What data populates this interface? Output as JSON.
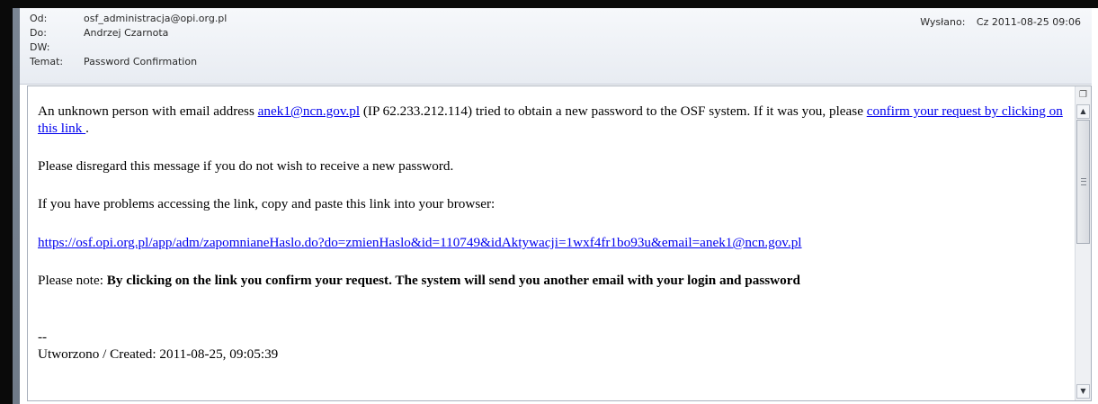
{
  "header": {
    "from_label": "Od:",
    "from_value": "osf_administracja@opi.org.pl",
    "to_label": "Do:",
    "to_value": "Andrzej Czarnota",
    "cc_label": "DW:",
    "cc_value": "",
    "subject_label": "Temat:",
    "subject_value": "Password Confirmation",
    "sent_label": "Wysłano:",
    "sent_value": "Cz 2011-08-25 09:06"
  },
  "message": {
    "p1_prefix": "An unknown person with email address ",
    "p1_email_link": "anek1@ncn.gov.pl",
    "p1_middle": " (IP 62.233.212.114) tried to obtain a new password to the OSF system. If it was you, please ",
    "p1_confirm_link": "confirm your request by clicking on this link ",
    "p1_suffix": ".",
    "p2": "Please disregard this message if you do not wish to receive a new password.",
    "p3": "If you have problems accessing the link, copy and paste this link into your browser:",
    "url_link": "https://osf.opi.org.pl/app/adm/zapomnianeHaslo.do?do=zmienHaslo&id=110749&idAktywacji=1wxf4fr1bo93u&email=anek1@ncn.gov.pl",
    "note_prefix": "Please note: ",
    "note_bold": "By clicking on the link you confirm your request. The system will send you another email with your login and password",
    "signature_sep": "--",
    "created": "Utworzono / Created: 2011-08-25, 09:05:39"
  },
  "scrollbar": {
    "up_glyph": "▲",
    "down_glyph": "▼",
    "page_icon": "❐"
  },
  "colors": {
    "link": "#0000ee",
    "header_bg": "#eef1f6"
  }
}
